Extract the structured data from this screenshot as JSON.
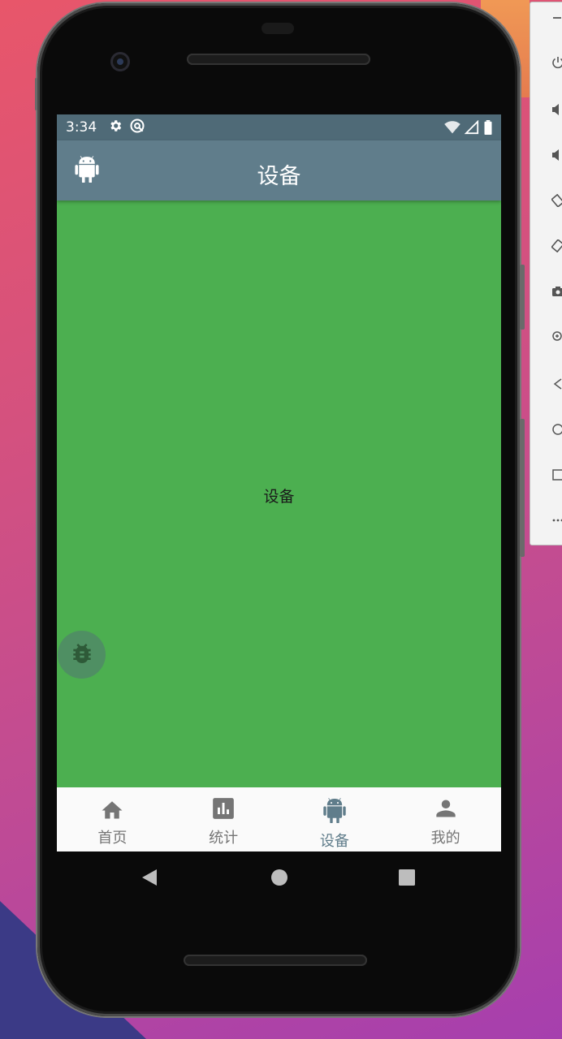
{
  "status_bar": {
    "time": "3:34",
    "icons": [
      "gear-icon",
      "sync-icon",
      "wifi-off-icon",
      "signal-icon",
      "battery-icon"
    ]
  },
  "app_bar": {
    "title": "设备",
    "leading_icon": "android-icon"
  },
  "main": {
    "center_text": "设备",
    "background_color": "#4caf50"
  },
  "debug_fab": {
    "icon": "bug-icon"
  },
  "bottom_nav": {
    "items": [
      {
        "label": "首页",
        "icon": "home-icon",
        "active": false
      },
      {
        "label": "统计",
        "icon": "chart-icon",
        "active": false
      },
      {
        "label": "设备",
        "icon": "android-icon",
        "active": true
      },
      {
        "label": "我的",
        "icon": "person-icon",
        "active": false
      }
    ],
    "active_color": "#607d8b"
  },
  "system_nav": [
    "back-icon",
    "home-circle-icon",
    "recents-icon"
  ],
  "emulator_toolbar": {
    "items": [
      "power-icon",
      "volume-up-icon",
      "volume-down-icon",
      "rotate-left-icon",
      "rotate-right-icon",
      "camera-icon",
      "zoom-icon",
      "back-icon",
      "home-icon",
      "overview-icon",
      "more-icon"
    ]
  },
  "colors": {
    "status_bar": "#4f6a77",
    "app_bar": "#607d8b",
    "nav_inactive": "#757575"
  }
}
